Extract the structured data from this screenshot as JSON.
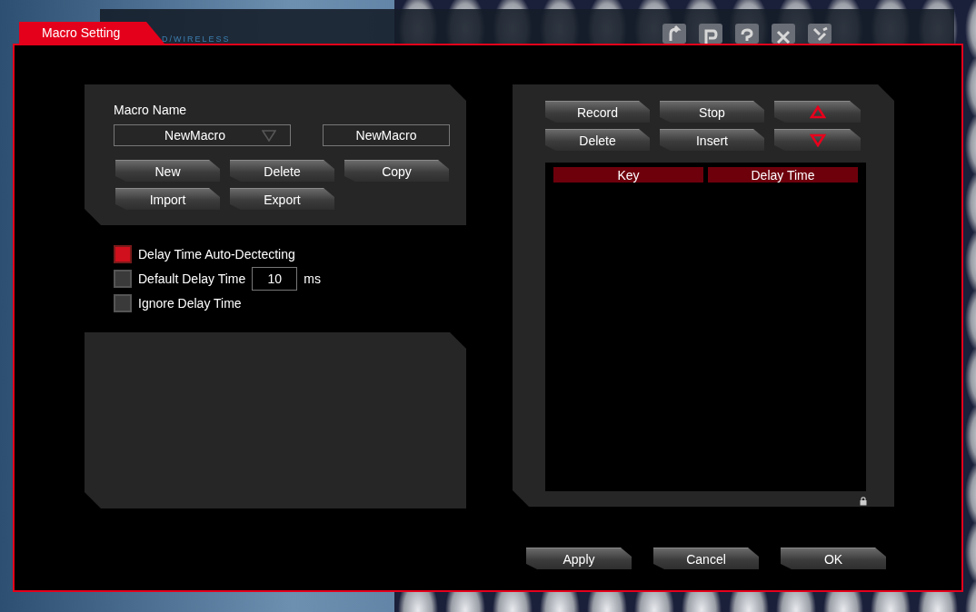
{
  "window": {
    "title": "Macro Setting"
  },
  "header": {
    "brand_text": "D/WIRELESS"
  },
  "macro": {
    "label": "Macro Name",
    "selected_macro": "NewMacro",
    "name_value": "NewMacro",
    "buttons": [
      "New",
      "Delete",
      "Copy",
      "Import",
      "Export"
    ]
  },
  "options": [
    {
      "kind": "checkbox",
      "label": "Delay Time Auto-Dectecting",
      "checked": true
    },
    {
      "kind": "value",
      "label": "Default Delay Time",
      "checked": false,
      "value": "10",
      "unit": "ms"
    },
    {
      "kind": "checkbox",
      "label": "Ignore Delay Time",
      "checked": false
    }
  ],
  "record_buttons": [
    {
      "kind": "text",
      "label": "Record"
    },
    {
      "kind": "text",
      "label": "Stop"
    },
    {
      "kind": "up"
    },
    {
      "kind": "text",
      "label": "Delete"
    },
    {
      "kind": "text",
      "label": "Insert"
    },
    {
      "kind": "down"
    }
  ],
  "table": {
    "columns": [
      "Key",
      "Delay Time"
    ]
  },
  "footer_buttons": [
    "Apply",
    "Cancel",
    "OK"
  ]
}
